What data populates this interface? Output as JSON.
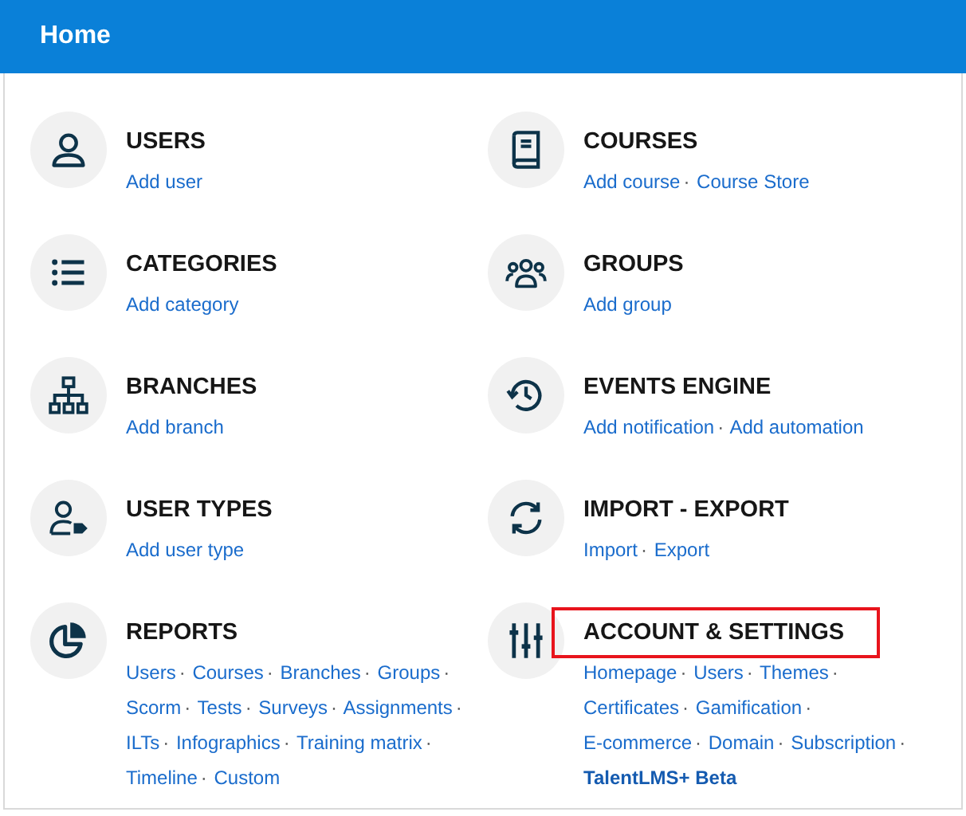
{
  "header": {
    "title": "Home"
  },
  "sections": [
    {
      "title": "USERS",
      "highlighted": false,
      "links": [
        {
          "label": "Add user",
          "bold": false
        }
      ]
    },
    {
      "title": "COURSES",
      "highlighted": false,
      "links": [
        {
          "label": "Add course",
          "bold": false,
          "separator": "·"
        },
        {
          "label": "Course Store",
          "bold": false
        }
      ]
    },
    {
      "title": "CATEGORIES",
      "highlighted": false,
      "links": [
        {
          "label": "Add category",
          "bold": false
        }
      ]
    },
    {
      "title": "GROUPS",
      "highlighted": false,
      "links": [
        {
          "label": "Add group",
          "bold": false
        }
      ]
    },
    {
      "title": "BRANCHES",
      "highlighted": false,
      "links": [
        {
          "label": "Add branch",
          "bold": false
        }
      ]
    },
    {
      "title": "EVENTS ENGINE",
      "highlighted": false,
      "links": [
        {
          "label": "Add notification",
          "bold": false,
          "separator": "·"
        },
        {
          "label": "Add automation",
          "bold": false
        }
      ]
    },
    {
      "title": "USER TYPES",
      "highlighted": false,
      "links": [
        {
          "label": "Add user type",
          "bold": false
        }
      ]
    },
    {
      "title": "IMPORT - EXPORT",
      "highlighted": false,
      "links": [
        {
          "label": "Import",
          "bold": false,
          "separator": "·"
        },
        {
          "label": "Export",
          "bold": false
        }
      ]
    },
    {
      "title": "REPORTS",
      "highlighted": false,
      "links": [
        {
          "label": "Users",
          "bold": false,
          "separator": "·"
        },
        {
          "label": "Courses",
          "bold": false,
          "separator": "·"
        },
        {
          "label": "Branches",
          "bold": false,
          "separator": "·"
        },
        {
          "label": "Groups",
          "bold": false,
          "separator": "·"
        },
        {
          "label": "Scorm",
          "bold": false,
          "separator": "·"
        },
        {
          "label": "Tests",
          "bold": false,
          "separator": "·"
        },
        {
          "label": "Surveys",
          "bold": false,
          "separator": "·"
        },
        {
          "label": "Assignments",
          "bold": false,
          "separator": "·"
        },
        {
          "label": "ILTs",
          "bold": false,
          "separator": "·"
        },
        {
          "label": "Infographics",
          "bold": false,
          "separator": "·"
        },
        {
          "label": "Training matrix",
          "bold": false,
          "separator": "·"
        },
        {
          "label": "Timeline",
          "bold": false,
          "separator": "·"
        },
        {
          "label": "Custom",
          "bold": false
        }
      ]
    },
    {
      "title": "ACCOUNT & SETTINGS",
      "highlighted": true,
      "links": [
        {
          "label": "Homepage",
          "bold": false,
          "separator": "·"
        },
        {
          "label": "Users",
          "bold": false,
          "separator": "·"
        },
        {
          "label": "Themes",
          "bold": false,
          "separator": "·"
        },
        {
          "label": "Certificates",
          "bold": false,
          "separator": "·"
        },
        {
          "label": "Gamification",
          "bold": false,
          "separator": "·"
        },
        {
          "label": "E-commerce",
          "bold": false,
          "separator": "·"
        },
        {
          "label": "Domain",
          "bold": false,
          "separator": "·"
        },
        {
          "label": "Subscription",
          "bold": false,
          "separator": "·"
        },
        {
          "label": "TalentLMS+ Beta",
          "bold": true
        }
      ]
    }
  ]
}
